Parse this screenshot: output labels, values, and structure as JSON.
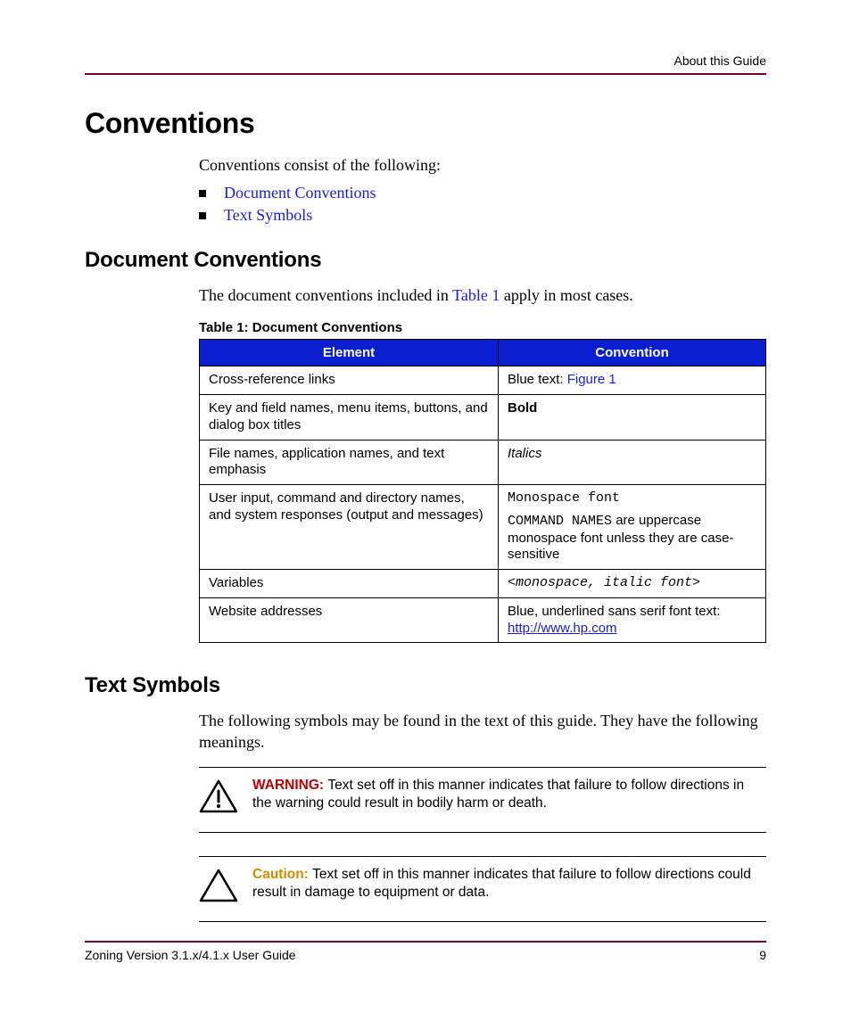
{
  "running_head": "About this Guide",
  "h1": "Conventions",
  "intro": "Conventions consist of the following:",
  "bullets": {
    "b1": "Document Conventions",
    "b2": "Text Symbols"
  },
  "sec1": {
    "heading": "Document Conventions",
    "para_pre": "The document conventions included in ",
    "para_link": "Table 1",
    "para_post": " apply in most cases.",
    "table_caption": "Table 1:  Document Conventions",
    "th_element": "Element",
    "th_convention": "Convention",
    "rows": {
      "r1e": "Cross-reference links",
      "r1c_pre": "Blue text: ",
      "r1c_link": "Figure 1",
      "r2e": "Key and field names, menu items, buttons, and dialog box titles",
      "r2c": "Bold",
      "r3e": "File names, application names, and text emphasis",
      "r3c": "Italics",
      "r4e": "User input, command and directory names, and system responses (output and messages)",
      "r4c_l1": "Monospace font",
      "r4c_l2a": "COMMAND NAMES",
      "r4c_l2b": " are uppercase monospace font unless they are case-sensitive",
      "r5e": "Variables",
      "r5c": "<monospace, italic font>",
      "r6e": "Website addresses",
      "r6c_pre": "Blue, underlined sans serif font text: ",
      "r6c_link": "http://www.hp.com"
    }
  },
  "sec2": {
    "heading": "Text Symbols",
    "para": "The following symbols may be found in the text of this guide. They have the following meanings.",
    "warning": {
      "label": "WARNING:  ",
      "text": "Text set off in this manner indicates that failure to follow directions in the warning could result in bodily harm or death."
    },
    "caution": {
      "label": "Caution:  ",
      "text": "Text set off in this manner indicates that failure to follow directions could result in damage to equipment or data."
    }
  },
  "footer": {
    "left": "Zoning Version 3.1.x/4.1.x User Guide",
    "right": "9"
  }
}
